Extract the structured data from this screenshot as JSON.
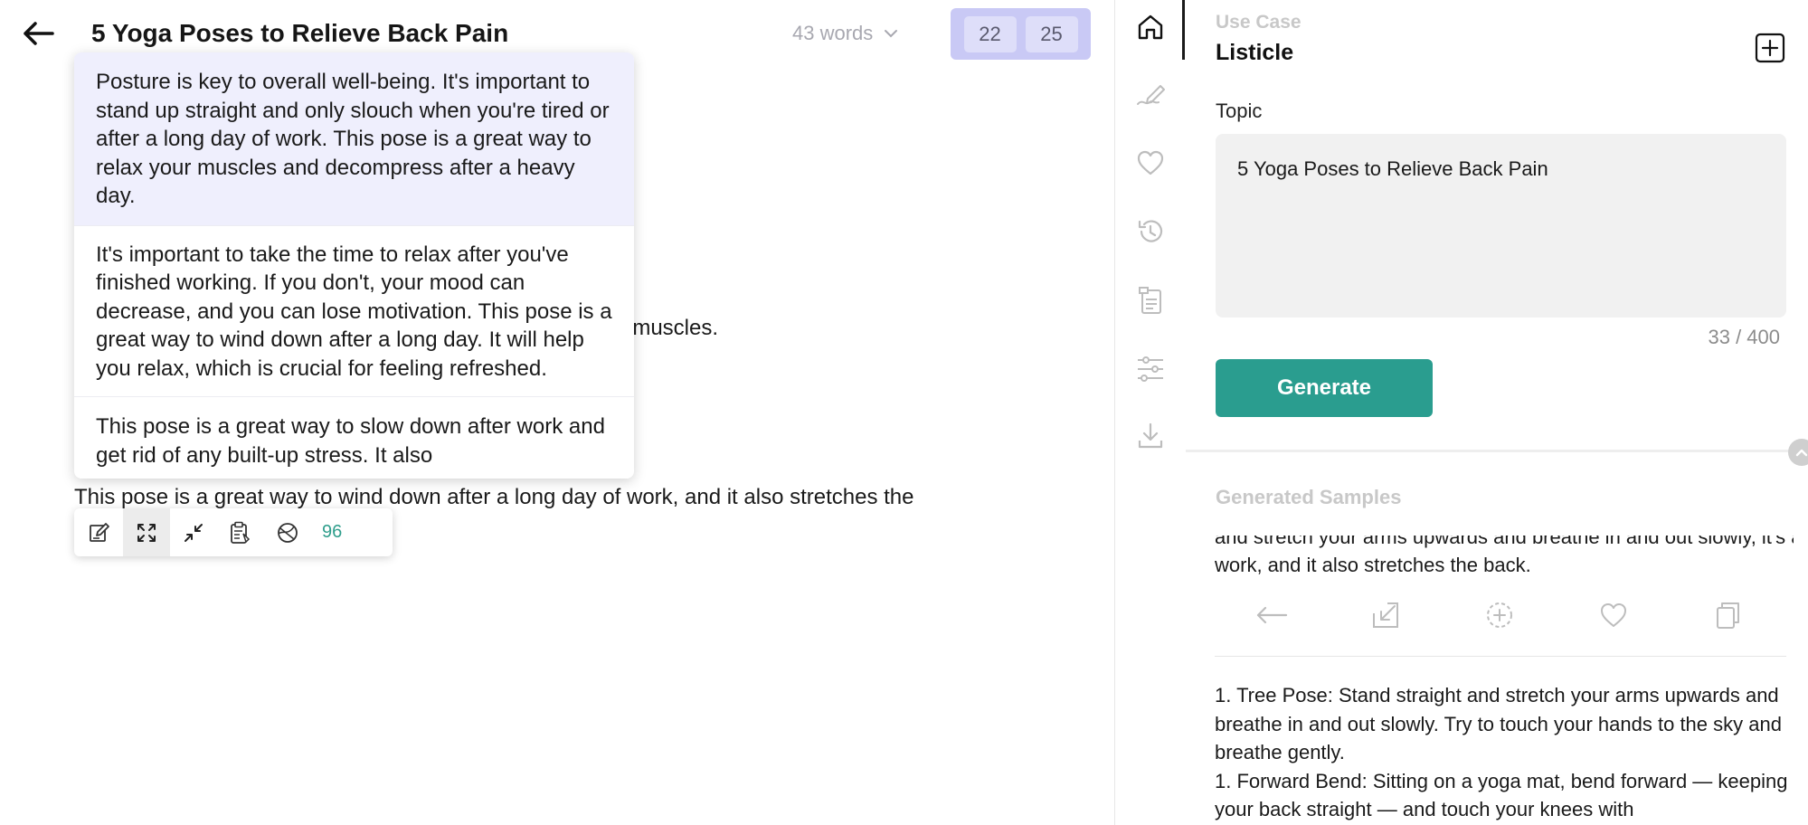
{
  "editor": {
    "title": "5 Yoga Poses to Relieve Back Pain",
    "word_count": "43 words",
    "counter_a": "22",
    "counter_b": "25",
    "body_line_muscles": "t muscles.",
    "body_line_main": "This pose is a great way to wind down after a long day of work, and it also stretches the"
  },
  "suggestions": [
    "Posture is key to overall well-being. It's important to stand up straight and only slouch when you're tired or after a long day of work. This pose is a great way to relax your muscles and decompress after a heavy day.",
    "It's important to take the time to relax after you've finished working. If you don't, your mood can decrease, and you can lose motivation. This pose is a great way to wind down after a long day. It will help you relax, which is crucial for feeling refreshed.",
    "This pose is a great way to slow down after work and get rid of any built-up stress. It also"
  ],
  "toolbar": {
    "score": "96"
  },
  "panel": {
    "use_case_label": "Use Case",
    "use_case_value": "Listicle",
    "topic_label": "Topic",
    "topic_value": "5 Yoga Poses to Relieve Back Pain",
    "char_count": "33 / 400",
    "generate_label": "Generate",
    "generated_samples_label": "Generated Samples",
    "sample_partial_cut": "and stretch your arms upwards and breathe in and out slowly, it's a great way to",
    "sample_partial_line": "work, and it also stretches the back.",
    "sample_lines": [
      "1. Tree Pose: Stand straight and stretch your arms upwards and breathe in and out slowly. Try to touch your hands to the sky and breathe gently.",
      "1. Forward Bend: Sitting on a yoga mat, bend forward — keeping your back straight — and touch your knees with"
    ]
  },
  "icons": {
    "back": "arrow-left-icon",
    "chevron": "chevron-down-icon",
    "nav": [
      "home-icon",
      "write-icon",
      "heart-icon",
      "history-icon",
      "document-icon",
      "sliders-icon",
      "download-icon"
    ],
    "toolbar": [
      "edit-icon",
      "expand-icon",
      "shrink-icon",
      "clipboard-icon",
      "rephrase-icon"
    ],
    "sample_actions": [
      "arrow-left-icon",
      "insert-icon",
      "add-circle-icon",
      "heart-icon",
      "copy-icon"
    ]
  },
  "colors": {
    "accent": "#2a9d8f",
    "counter_bg": "#c9c9f5",
    "suggestion_highlight": "#efeffd"
  }
}
